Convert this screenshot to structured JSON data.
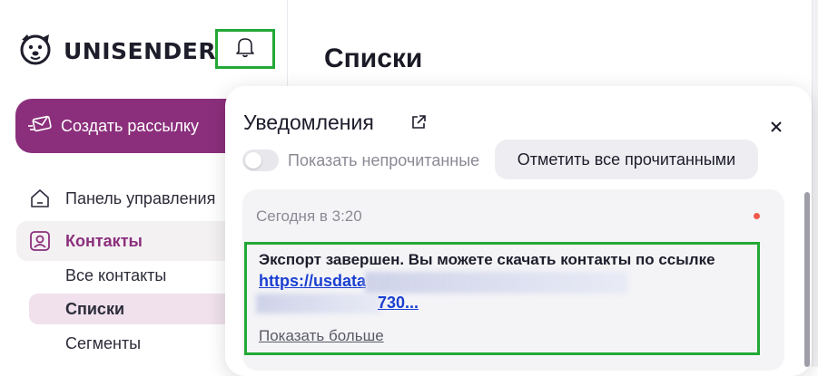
{
  "sidebar": {
    "logo_text": "UNISENDER",
    "create_button_label": "Создать рассылку",
    "items": [
      {
        "label": "Панель управления",
        "icon": "home-icon"
      },
      {
        "label": "Контакты",
        "icon": "contacts-icon"
      }
    ],
    "subitems": [
      "Все контакты",
      "Списки",
      "Сегменты"
    ]
  },
  "page": {
    "title": "Списки"
  },
  "notifications": {
    "title": "Уведомления",
    "toggle_label": "Показать непрочитанные",
    "mark_all_label": "Отметить все прочитанными",
    "items": [
      {
        "time": "Сегодня в 3:20",
        "message": "Экспорт завершен. Вы можете скачать контакты по ссылке",
        "link_line1": "https://usdata",
        "link_line2": "730...",
        "show_more": "Показать больше"
      }
    ]
  },
  "colors": {
    "brand": "#8b2f7c",
    "highlight": "#23a836",
    "link": "#1a3fd1",
    "unread_dot": "#ef5a4c"
  }
}
